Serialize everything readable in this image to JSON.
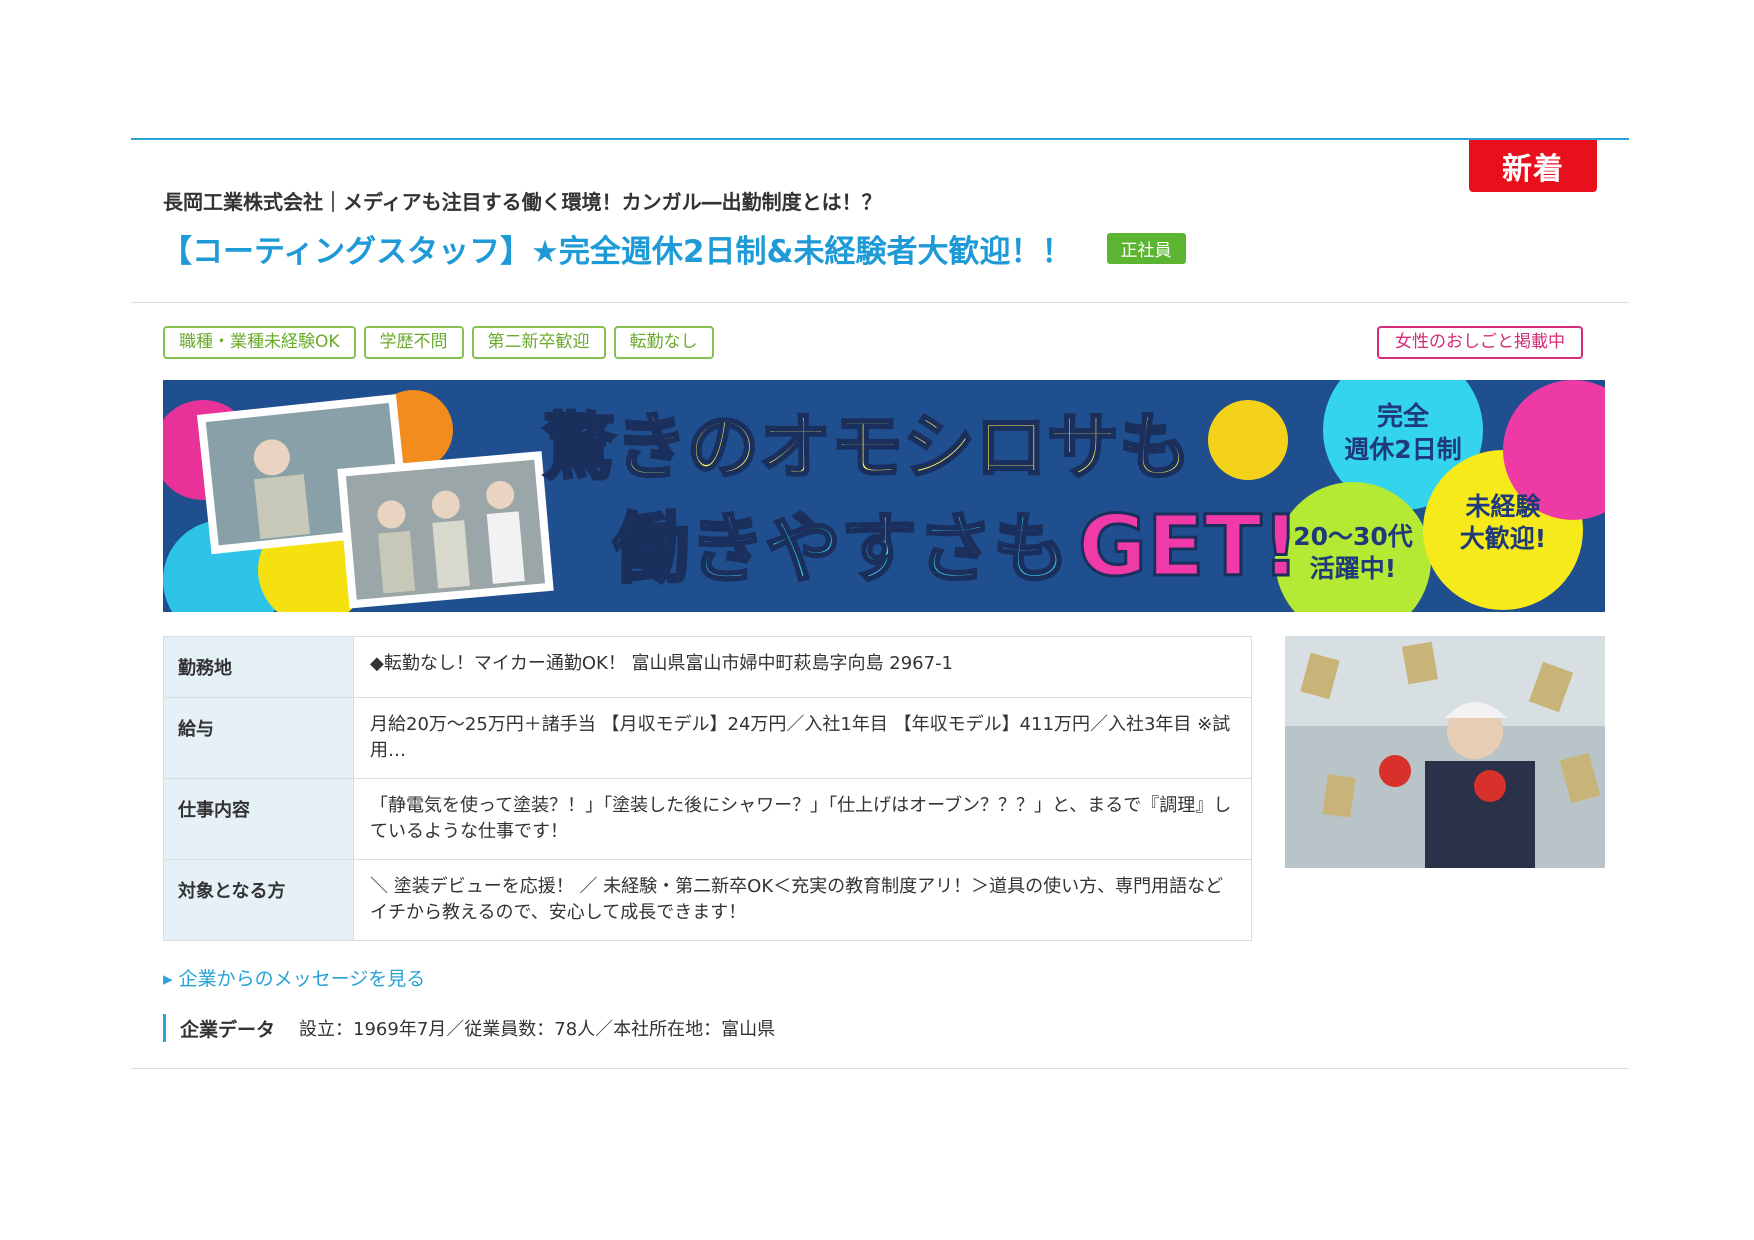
{
  "new_badge": "新着",
  "company_headline": "長岡工業株式会社｜メディアも注目する働く環境！カンガル―出勤制度とは！？",
  "job_title": "【コーティングスタッフ】★完全週休2日制&未経験者大歓迎！！",
  "employment_type": "正社員",
  "tags": [
    "職種・業種未経験OK",
    "学歴不問",
    "第二新卒歓迎",
    "転勤なし"
  ],
  "women_tag": "女性のおしごと掲載中",
  "banner": {
    "line1": "驚きのオモシロサも",
    "line2_a": "働きやすさも",
    "line2_b": "GET!",
    "bubble_holiday_1": "完全",
    "bubble_holiday_2": "週休2日制",
    "bubble_age_1": "20～30代",
    "bubble_age_2": "活躍中!",
    "bubble_inexp_1": "未経験",
    "bubble_inexp_2": "大歓迎!"
  },
  "details": [
    {
      "label": "勤務地",
      "value": "◆転勤なし！マイカー通勤OK！ 富山県富山市婦中町萩島字向島 2967-1"
    },
    {
      "label": "給与",
      "value": "月給20万～25万円＋諸手当 【月収モデル】24万円／入社1年目 【年収モデル】411万円／入社3年目 ※試用…"
    },
    {
      "label": "仕事内容",
      "value": "「静電気を使って塗装？！」「塗装した後にシャワー？」「仕上げはオーブン？？？」と、まるで『調理』しているような仕事です！"
    },
    {
      "label": "対象となる方",
      "value": "＼ 塗装デビューを応援！ ／ 未経験・第二新卒OK＜充実の教育制度アリ！＞道具の使い方、専門用語などイチから教えるので、安心して成長できます！"
    }
  ],
  "message_link": "▸ 企業からのメッセージを見る",
  "company_data": {
    "label": "企業データ",
    "text": "設立：1969年7月／従業員数：78人／本社所在地：富山県"
  },
  "colors": {
    "accent": "#29a3d6",
    "new": "#e8101c",
    "green": "#5cb531",
    "pink": "#d52c78"
  }
}
